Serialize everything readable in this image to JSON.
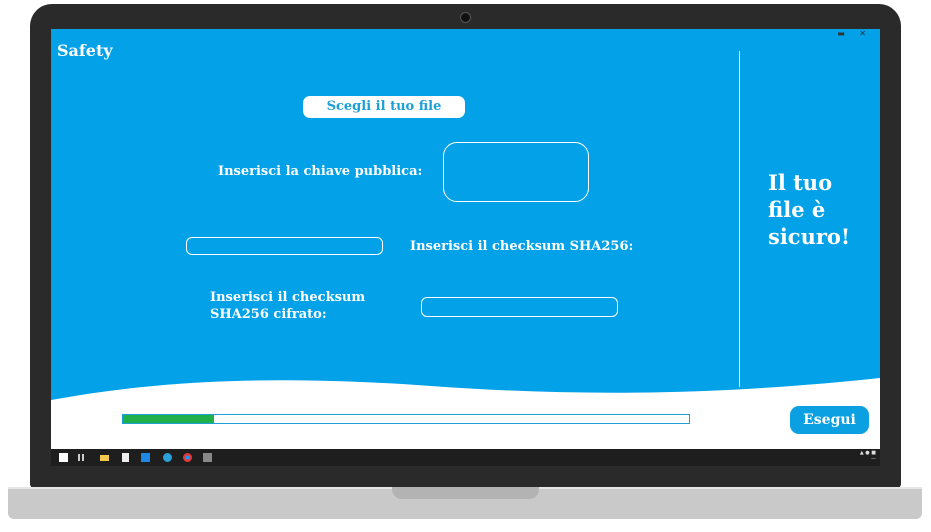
{
  "app": {
    "title": "Safety"
  },
  "main": {
    "choose_file_button": "Scegli il tuo file",
    "public_key_label": "Inserisci la chiave pubblica:",
    "checksum_label": "Inserisci il checksum SHA256:",
    "encrypted_checksum_label_line1": "Inserisci il checksum",
    "encrypted_checksum_label_line2": "SHA256 cifrato:",
    "public_key_value": "",
    "checksum_value": "",
    "encrypted_checksum_value": ""
  },
  "side": {
    "status_line1": "Il tuo",
    "status_line2": "file è",
    "status_line3": "sicuro!"
  },
  "footer": {
    "progress_fraction": 0.16,
    "run_button": "Esegui"
  },
  "colors": {
    "background": "#03a1e8",
    "progress": "#20b04b",
    "accent": "#1da0d6"
  },
  "taskbar": {
    "icons": [
      "start-icon",
      "task-view-icon",
      "file-explorer-icon",
      "document-icon",
      "vscode-icon",
      "edge-icon",
      "chrome-icon",
      "app-icon"
    ]
  }
}
